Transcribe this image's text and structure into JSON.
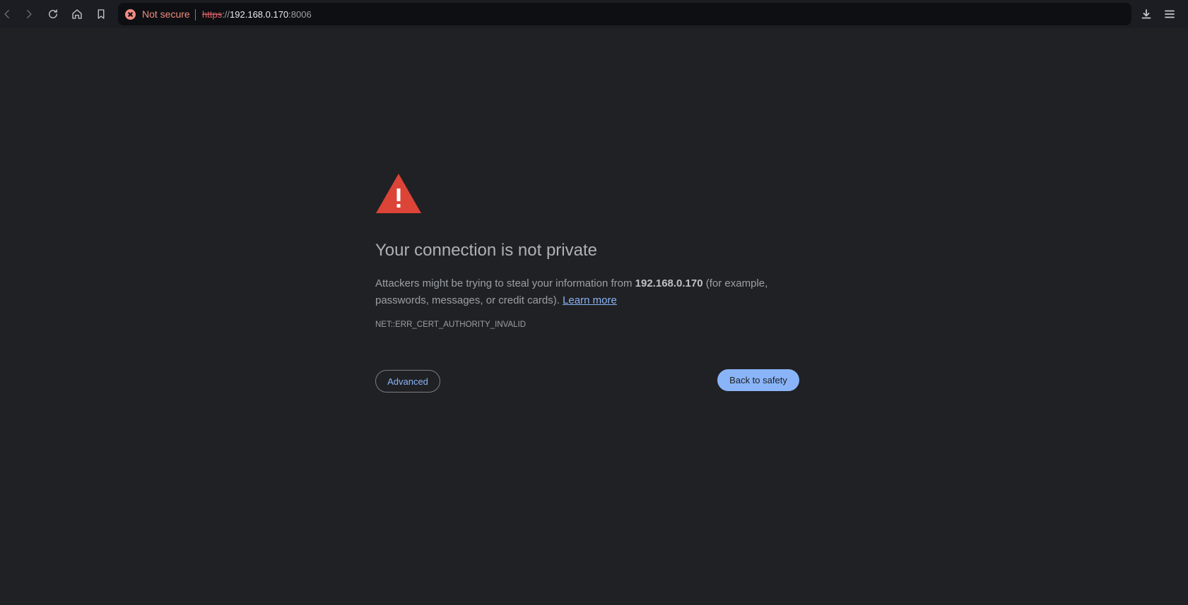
{
  "toolbar": {
    "icons": {
      "back": "back-arrow-icon",
      "forward": "forward-arrow-icon",
      "reload": "reload-icon",
      "home": "home-icon",
      "bookmark": "bookmark-icon",
      "share": "share-icon",
      "brave": "brave-lion-icon",
      "download": "download-icon",
      "menu": "hamburger-menu-icon"
    },
    "security_label": "Not secure",
    "url": {
      "scheme": "https",
      "separator": "://",
      "host": "192.168.0.170",
      "port": ":8006"
    }
  },
  "interstitial": {
    "heading": "Your connection is not private",
    "message_prefix": "Attackers might be trying to steal your information from ",
    "message_host": "192.168.0.170",
    "message_suffix": " (for example, passwords, messages, or credit cards). ",
    "learn_more": "Learn more",
    "error_code": "NET::ERR_CERT_AUTHORITY_INVALID",
    "advanced_label": "Advanced",
    "back_to_safety_label": "Back to safety"
  },
  "colors": {
    "page_background": "#202124",
    "warning_red": "#db4437",
    "link_blue": "#8ab4f8",
    "not_secure_red": "#f28b82"
  }
}
